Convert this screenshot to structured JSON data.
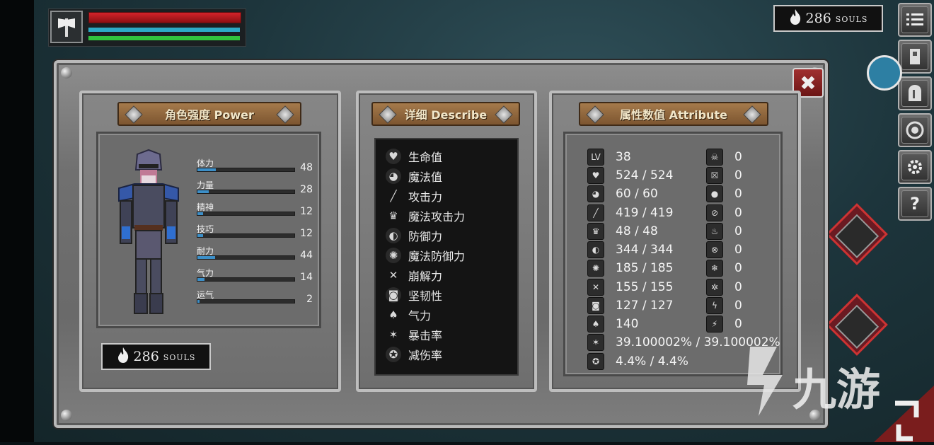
{
  "hud": {
    "hp_pct": 100,
    "mp_pct": 100,
    "stamina_pct": 100,
    "weapon_icon": "axe-icon"
  },
  "souls": {
    "amount": "286",
    "unit": "SOULS"
  },
  "side_buttons": [
    "menu-list-icon",
    "character-icon",
    "helmet-icon",
    "skill-icon",
    "settings-gear-icon",
    "help-icon"
  ],
  "panels": {
    "power": {
      "title": "角色强度 Power",
      "stats": [
        {
          "label": "体力",
          "value": "48",
          "level": 0.19
        },
        {
          "label": "力量",
          "value": "28",
          "level": 0.12
        },
        {
          "label": "精神",
          "value": "12",
          "level": 0.06
        },
        {
          "label": "技巧",
          "value": "12",
          "level": 0.06
        },
        {
          "label": "耐力",
          "value": "44",
          "level": 0.18
        },
        {
          "label": "气力",
          "value": "14",
          "level": 0.07
        },
        {
          "label": "运气",
          "value": "2",
          "level": 0.02
        }
      ]
    },
    "describe": {
      "title": "详细 Describe",
      "items": [
        "生命值",
        "魔法值",
        "攻击力",
        "魔法攻击力",
        "防御力",
        "魔法防御力",
        "崩解力",
        "坚韧性",
        "气力",
        "暴击率",
        "减伤率"
      ]
    },
    "attribute": {
      "title": "属性数值 Attribute",
      "level_label": "LV",
      "left_values": [
        "38",
        "524 / 524",
        "60 / 60",
        "419 / 419",
        "48 / 48",
        "344 / 344",
        "185 / 185",
        "155 / 155",
        "127 / 127",
        "140",
        "39.100002% / 39.100002%",
        "4.4% / 4.4%"
      ],
      "right_values": [
        "0",
        "0",
        "0",
        "0",
        "0",
        "0",
        "0",
        "0",
        "0",
        "0",
        "0"
      ]
    }
  },
  "watermark": "九游",
  "colors": {
    "hp": "#d4232a",
    "mp": "#2cabc7",
    "stamina": "#31c43d",
    "banner": "#8f6539",
    "stat_fill": "#3c8fc8"
  }
}
